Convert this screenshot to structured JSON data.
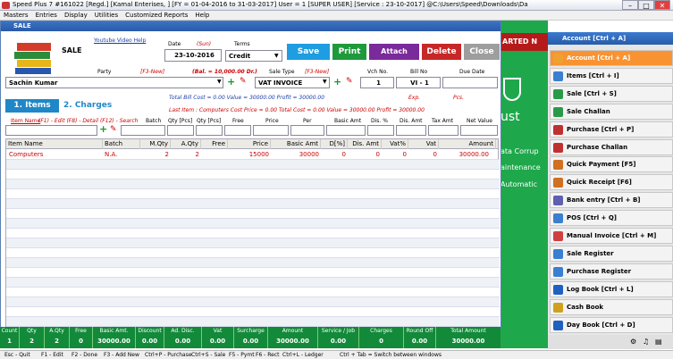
{
  "window": {
    "title": "Speed Plus 7 #161022  [Regd.]  [Kamal Enterises, ]  [FY = 01-04-2016 to 31-03-2017]  User = 1  [SUPER USER]  [Service : 23-10-2017]  @C:\\Users\\Speed\\Downloads\\Da",
    "minimize": "–",
    "maximize": "□",
    "close": "✕"
  },
  "menu": [
    "Masters",
    "Entries",
    "Display",
    "Utilities",
    "Customized Reports",
    "Help"
  ],
  "background": {
    "banner": "ARTED N",
    "lines": [
      "ust",
      "ata Corrup",
      "aintenance",
      "Automatic"
    ]
  },
  "sale": {
    "window_title": "SALE",
    "heading": "SALE",
    "youtube": "Youtube Video Help",
    "date_label": "Date",
    "day": "(Sun)",
    "date": "23-10-2016",
    "terms_label": "Terms",
    "terms": "Credit",
    "buttons": {
      "save": "Save",
      "print": "Print",
      "attach": "Attach",
      "delete": "Delete",
      "close": "Close"
    },
    "party_label": "Party",
    "party_hint": "[F3-New]",
    "balance": "(Bal. = 10,000.00 Dr.)",
    "party": "Sachin Kumar",
    "saletype_label": "Sale Type",
    "saletype_hint": "[F3-New]",
    "saletype": "VAT INVOICE",
    "vch_label": "Vch No.",
    "vch": "1",
    "bill_label": "Bill No",
    "bill": "VI - 1",
    "due_label": "Due Date",
    "due": "",
    "tab_items": "1. Items",
    "tab_charges": "2. Charges",
    "summary1": "Total Bill Cost = 0.00     Value = 30000.00     Profit = 30000.00",
    "summary2": "Last Item : Computers     Cost Price = 0.00     Total Cost = 0.00     Value = 30000.00     Profit = 30000.00",
    "exp": "Exp.",
    "pcs": "Pcs.",
    "entry_labels": {
      "item": "Item Name",
      "help": "(F1) - Edit  (F8) - Detail  (F12) - Search",
      "batch": "Batch",
      "qty": "Qty [Pcs]",
      "aqty": "Qty [Pcs]",
      "free": "Free",
      "price": "Price",
      "per": "Per",
      "basic": "Basic Amt",
      "dis": "Dis. %",
      "disamt": "Dis. Amt",
      "tax": "Tax Amt",
      "net": "Net Value"
    },
    "columns": [
      "Item Name",
      "Batch",
      "M.Qty",
      "A.Qty",
      "Free",
      "Price",
      "Basic Amt",
      "D[%]",
      "Dis. Amt",
      "Vat%",
      "Vat",
      "Amount"
    ],
    "rows": [
      [
        "Computers",
        "N.A.",
        "2",
        "2",
        "",
        "15000",
        "30000",
        "0",
        "0",
        "0",
        "0",
        "30000.00"
      ]
    ]
  },
  "totals": [
    {
      "h": "Count",
      "v": "1"
    },
    {
      "h": "Qty",
      "v": "2"
    },
    {
      "h": "A.Qty",
      "v": "2"
    },
    {
      "h": "Free",
      "v": "0"
    },
    {
      "h": "Basic Amt.",
      "v": "30000.00"
    },
    {
      "h": "Discount",
      "v": "0.00"
    },
    {
      "h": "Ad. Disc.",
      "v": "0.00"
    },
    {
      "h": "Vat",
      "v": "0.00"
    },
    {
      "h": "Surcharge",
      "v": "0.00"
    },
    {
      "h": "Amount",
      "v": "30000.00"
    },
    {
      "h": "Service / Job",
      "v": "0.00"
    },
    {
      "h": "Charges",
      "v": "0"
    },
    {
      "h": "Round Off",
      "v": "0.00"
    },
    {
      "h": "Total Amount",
      "v": "30000.00"
    }
  ],
  "status": [
    "Esc - Quit",
    "F1 - Edit",
    "F2 - Done",
    "F3 - Add New",
    "Ctrl+P - Purchase",
    "Ctrl+S - Sale",
    "F5 - Pymt",
    "F6 - Rect",
    "Ctrl+L - Ledger",
    "Ctrl + Tab = Switch between windows"
  ],
  "nav": {
    "header": "Account [Ctrl + A]",
    "items": [
      "Account [Ctrl + A]",
      "Items [Ctrl + I]",
      "Sale [Ctrl + S]",
      "Sale Challan",
      "Purchase [Ctrl + P]",
      "Purchase Challan",
      "Quick Payment [F5]",
      "Quick Receipt [F6]",
      "Bank entry [Ctrl + B]",
      "POS [Ctrl + Q]",
      "Manual Invoice [Ctrl + M]",
      "Sale Register",
      "Purchase Register",
      "Log Book [Ctrl + L]",
      "Cash Book",
      "Day Book [Ctrl + D]"
    ],
    "icon_colors": [
      "#f0a030",
      "#3a7fd0",
      "#2a9a4a",
      "#2a9a4a",
      "#c03030",
      "#c03030",
      "#d07020",
      "#d07020",
      "#6060b0",
      "#3a7fd0",
      "#d04040",
      "#3a7fd0",
      "#3a7fd0",
      "#2060c0",
      "#d0a020",
      "#2060c0"
    ]
  },
  "colors": {
    "save": "#1e9de0",
    "print": "#1e9a3c",
    "attach": "#7a2a9a",
    "delete": "#c62828",
    "close": "#9e9e9e",
    "totals": "#128a3a",
    "nav_selected": "#f99332"
  }
}
